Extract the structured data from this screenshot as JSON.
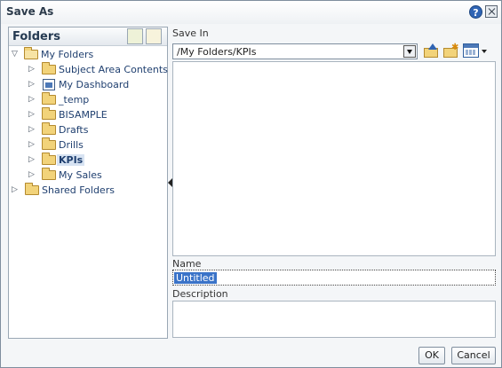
{
  "dialog": {
    "title": "Save As",
    "help_icon": "question-mark-icon",
    "close_icon": "close-icon"
  },
  "folders": {
    "title": "Folders",
    "tree": [
      {
        "label": "My Folders",
        "expanded": true,
        "icon": "folder-open-icon"
      },
      {
        "label": "Subject Area Contents",
        "icon": "folder-icon"
      },
      {
        "label": "My Dashboard",
        "icon": "dashboard-icon"
      },
      {
        "label": "_temp",
        "icon": "folder-icon"
      },
      {
        "label": "BISAMPLE",
        "icon": "folder-icon"
      },
      {
        "label": "Drafts",
        "icon": "folder-icon"
      },
      {
        "label": "Drills",
        "icon": "folder-icon"
      },
      {
        "label": "KPIs",
        "icon": "folder-icon",
        "selected": true
      },
      {
        "label": "My Sales",
        "icon": "folder-icon"
      },
      {
        "label": "Shared Folders",
        "icon": "folder-icon"
      }
    ]
  },
  "save_in": {
    "label": "Save In",
    "path": "/My Folders/KPIs"
  },
  "name": {
    "label": "Name",
    "value": "Untitled"
  },
  "description": {
    "label": "Description",
    "value": ""
  },
  "buttons": {
    "ok": "OK",
    "cancel": "Cancel"
  },
  "colors": {
    "accent": "#2f64b4",
    "selection": "#3a73c8",
    "folder": "#f2d37a"
  }
}
